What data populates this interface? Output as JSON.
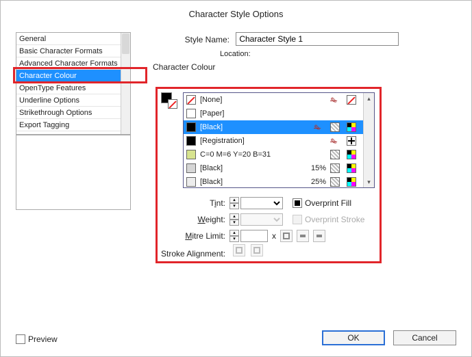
{
  "title": "Character Style Options",
  "header": {
    "style_name_label": "Style Name:",
    "style_name_value": "Character Style 1",
    "location_label": "Location:"
  },
  "section_title": "Character Colour",
  "sidebar": {
    "items": [
      {
        "label": "General"
      },
      {
        "label": "Basic Character Formats"
      },
      {
        "label": "Advanced Character Formats"
      },
      {
        "label": "Character Colour",
        "selected": true
      },
      {
        "label": "OpenType Features"
      },
      {
        "label": "Underline Options"
      },
      {
        "label": "Strikethrough Options"
      },
      {
        "label": "Export Tagging"
      }
    ]
  },
  "swatches": [
    {
      "name": "[None]",
      "box": "none",
      "pct": "",
      "flags": [
        "pencil",
        "none-red"
      ]
    },
    {
      "name": "[Paper]",
      "box": "white",
      "pct": "",
      "flags": []
    },
    {
      "name": "[Black]",
      "box": "black",
      "pct": "",
      "selected": true,
      "flags": [
        "pencil",
        "hatch",
        "cmyk"
      ]
    },
    {
      "name": "[Registration]",
      "box": "black",
      "pct": "",
      "flags": [
        "pencil",
        "plus"
      ]
    },
    {
      "name": "C=0 M=6 Y=20 B=31",
      "box": "lime",
      "pct": "",
      "flags": [
        "hatch",
        "cmyk"
      ]
    },
    {
      "name": "[Black]",
      "box": "grey",
      "pct": "15%",
      "flags": [
        "hatch",
        "cmyk"
      ]
    },
    {
      "name": "[Black]",
      "box": "lt",
      "pct": "25%",
      "flags": [
        "hatch",
        "cmyk"
      ]
    }
  ],
  "form": {
    "tint_label_pre": "T",
    "tint_label_ul": "i",
    "tint_label_post": "nt:",
    "weight_label_pre": "",
    "weight_label_ul": "W",
    "weight_label_post": "eight:",
    "mitre_label_pre": "",
    "mitre_label_ul": "M",
    "mitre_label_post": "itre Limit:",
    "tint_value": "",
    "weight_value": "",
    "mitre_value": "",
    "mitre_suffix": "x",
    "overprint_fill_label": "Overprint Fill",
    "overprint_stroke_label": "Overprint Stroke",
    "stroke_alignment_label": "Stroke Alignment:"
  },
  "footer": {
    "preview_label": "Preview",
    "ok_label": "OK",
    "cancel_label": "Cancel"
  }
}
